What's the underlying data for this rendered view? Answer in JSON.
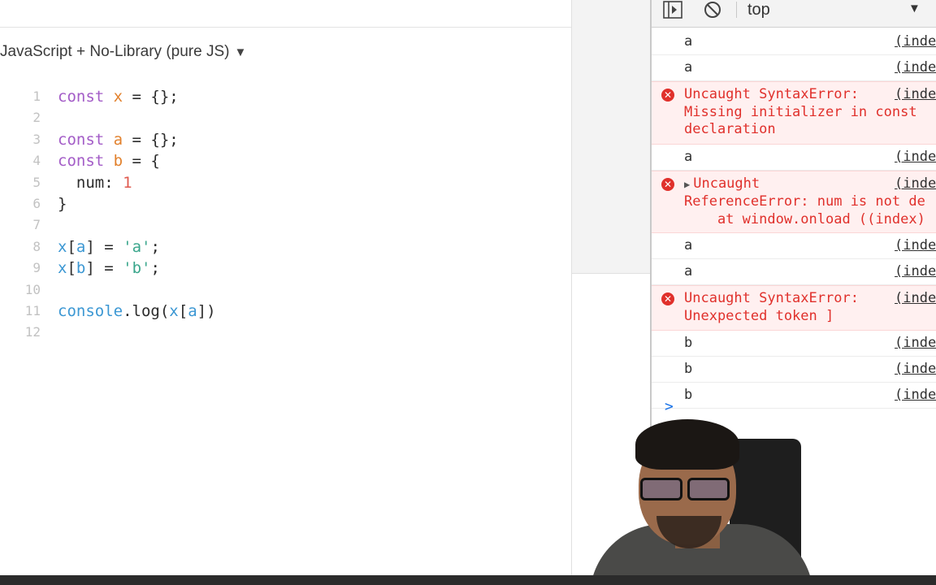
{
  "editor": {
    "language_selector": "JavaScript + No-Library (pure JS)",
    "code_lines": [
      {
        "n": "1",
        "tokens": [
          [
            "kw",
            "const "
          ],
          [
            "var",
            "x"
          ],
          [
            "pl",
            " = {};"
          ]
        ]
      },
      {
        "n": "2",
        "tokens": []
      },
      {
        "n": "3",
        "tokens": [
          [
            "kw",
            "const "
          ],
          [
            "var",
            "a"
          ],
          [
            "pl",
            " = {};"
          ]
        ]
      },
      {
        "n": "4",
        "tokens": [
          [
            "kw",
            "const "
          ],
          [
            "var",
            "b"
          ],
          [
            "pl",
            " = {"
          ]
        ]
      },
      {
        "n": "5",
        "tokens": [
          [
            "pl",
            "  num: "
          ],
          [
            "num",
            "1"
          ]
        ]
      },
      {
        "n": "6",
        "tokens": [
          [
            "pl",
            "}"
          ]
        ]
      },
      {
        "n": "7",
        "tokens": []
      },
      {
        "n": "8",
        "tokens": [
          [
            "id",
            "x"
          ],
          [
            "pl",
            "["
          ],
          [
            "id",
            "a"
          ],
          [
            "pl",
            "] = "
          ],
          [
            "str",
            "'a'"
          ],
          [
            "pl",
            ";"
          ]
        ]
      },
      {
        "n": "9",
        "tokens": [
          [
            "id",
            "x"
          ],
          [
            "pl",
            "["
          ],
          [
            "id",
            "b"
          ],
          [
            "pl",
            "] = "
          ],
          [
            "str",
            "'b'"
          ],
          [
            "pl",
            ";"
          ]
        ]
      },
      {
        "n": "10",
        "tokens": []
      },
      {
        "n": "11",
        "tokens": [
          [
            "fn",
            "console"
          ],
          [
            "pl",
            ".log("
          ],
          [
            "id",
            "x"
          ],
          [
            "pl",
            "["
          ],
          [
            "id",
            "a"
          ],
          [
            "pl",
            "])"
          ]
        ]
      },
      {
        "n": "12",
        "tokens": []
      }
    ]
  },
  "devtools": {
    "context": "top",
    "messages": [
      {
        "type": "log",
        "text": "a",
        "source": "(inde"
      },
      {
        "type": "log",
        "text": "a",
        "source": "(inde"
      },
      {
        "type": "error",
        "lines": [
          "Uncaught SyntaxError:",
          "Missing initializer in const",
          "declaration"
        ],
        "source": "(inde"
      },
      {
        "type": "log",
        "text": "a",
        "source": "(inde"
      },
      {
        "type": "error",
        "expandable": true,
        "lines": [
          "Uncaught",
          "ReferenceError: num is not de",
          "    at window.onload ((index)"
        ],
        "source": "(inde"
      },
      {
        "type": "log",
        "text": "a",
        "source": "(inde"
      },
      {
        "type": "log",
        "text": "a",
        "source": "(inde"
      },
      {
        "type": "error",
        "lines": [
          "Uncaught SyntaxError:",
          "Unexpected token ]"
        ],
        "source": "(inde"
      },
      {
        "type": "log",
        "text": "b",
        "source": "(inde"
      },
      {
        "type": "log",
        "text": "b",
        "source": "(inde"
      },
      {
        "type": "log",
        "text": "b",
        "source": "(inde"
      }
    ],
    "prompt": ">"
  },
  "colors": {
    "keyword": "#a35cc7",
    "variable": "#e2812d",
    "identifier": "#3b97d3",
    "string": "#3aa68c",
    "number": "#e05a4f",
    "error": "#e0302b"
  },
  "icons": [
    "sidebar-toggle-icon",
    "clear-console-icon",
    "dropdown-caret-icon",
    "error-icon",
    "expand-triangle-icon",
    "console-prompt-icon"
  ]
}
